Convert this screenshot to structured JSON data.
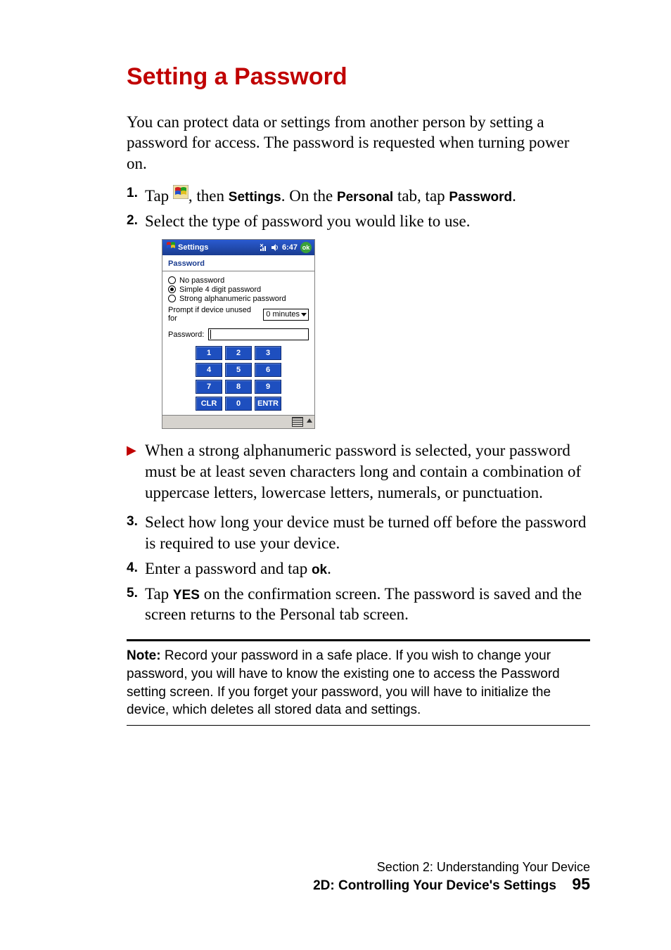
{
  "heading": "Setting a Password",
  "intro": "You can protect data or settings from another person by setting a password for access. The password is requested when turning power on.",
  "steps": {
    "s1_num": "1.",
    "s1_a": "Tap ",
    "s1_b": ", then ",
    "s1_settings": "Settings",
    "s1_c": ". On the ",
    "s1_personal": "Personal",
    "s1_d": " tab, tap ",
    "s1_password": "Password",
    "s1_e": ".",
    "s2_num": "2.",
    "s2_text": "Select the type of password you would like to use.",
    "bullet": "When a strong alphanumeric password is selected, your password must be at least seven characters long and contain a combination of uppercase letters, lowercase letters, numerals, or punctuation.",
    "s3_num": "3.",
    "s3_text": "Select how long your device must be turned off before the password is required to use your device.",
    "s4_num": "4.",
    "s4_a": "Enter a password and tap ",
    "s4_ok": "ok",
    "s4_b": ".",
    "s5_num": "5.",
    "s5_a": "Tap ",
    "s5_yes": "YES",
    "s5_b": " on the confirmation screen. The password is saved and the screen returns to the Personal tab screen."
  },
  "note": {
    "label": "Note:",
    "text": " Record your password in a safe place. If you wish to change your password, you will have to know the existing one to access the Password setting screen. If you forget your password, you will have to initialize the device, which deletes all stored data and settings."
  },
  "footer": {
    "section": "Section 2: Understanding Your Device",
    "chapter": "2D: Controlling Your Device's Settings",
    "page": "95"
  },
  "device": {
    "title": "Settings",
    "time": "6:47",
    "ok": "ok",
    "subtitle": "Password",
    "radios": [
      "No password",
      "Simple 4 digit password",
      "Strong alphanumeric password"
    ],
    "prompt_label": "Prompt if device unused for",
    "prompt_value": "0 minutes",
    "password_label": "Password:",
    "keys": [
      "1",
      "2",
      "3",
      "4",
      "5",
      "6",
      "7",
      "8",
      "9",
      "CLR",
      "0",
      "ENTR"
    ]
  }
}
